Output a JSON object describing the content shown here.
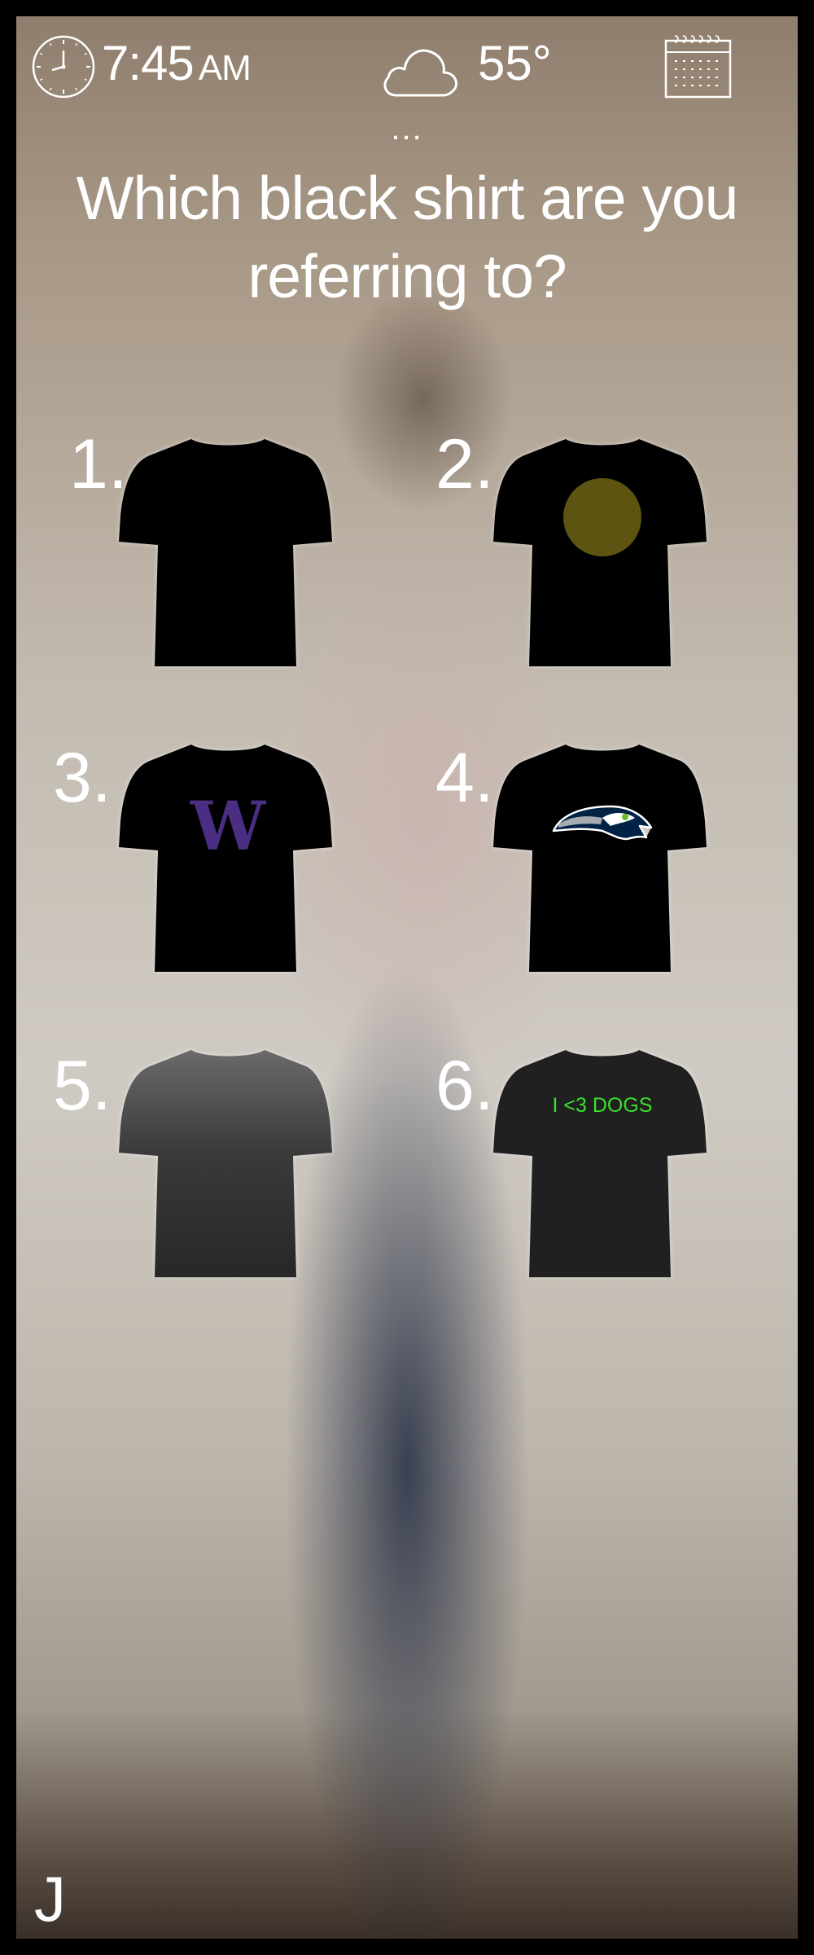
{
  "status_bar": {
    "time": "7:45",
    "am_pm": "AM",
    "temperature": "55°",
    "icons": {
      "clock": "clock-icon",
      "weather": "cloud-icon",
      "calendar": "calendar-icon"
    }
  },
  "ellipsis": "...",
  "prompt": {
    "line1": "Which black shirt are you",
    "line2": "referring to?"
  },
  "options": [
    {
      "number": "1.",
      "description": "plain black shirt"
    },
    {
      "number": "2.",
      "description": "black shirt with olive circle",
      "graphic_color": "#5e5411"
    },
    {
      "number": "3.",
      "description": "black shirt with purple W",
      "logo_text": "W",
      "logo_color": "#4b2e83"
    },
    {
      "number": "4.",
      "description": "black shirt with seahawk logo",
      "logo_icon": "seahawk-logo-icon"
    },
    {
      "number": "5.",
      "description": "faded gray-black gradient shirt"
    },
    {
      "number": "6.",
      "description": "dark shirt with green text",
      "shirt_text": "I <3 DOGS",
      "text_color": "#39e02c"
    }
  ],
  "footer": {
    "monogram": "J"
  }
}
